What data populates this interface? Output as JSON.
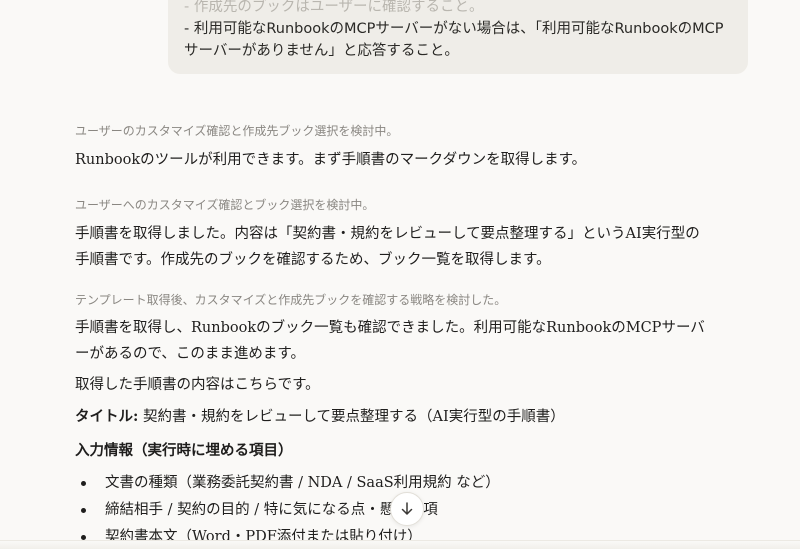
{
  "user_message": {
    "line_faded": "- 作成先のブックはユーザーに確認すること。",
    "line1": "- 利用可能なRunbookのMCPサーバーがない場合は、「利用可能なRunbookのMCP",
    "line2": "サーバーがありません」と応答すること。"
  },
  "assistant": {
    "thought1": "ユーザーのカスタマイズ確認と作成先ブック選択を検討中。",
    "para1": "Runbookのツールが利用できます。まず手順書のマークダウンを取得します。",
    "thought2": "ユーザーへのカスタマイズ確認とブック選択を検討中。",
    "para2_line1": "手順書を取得しました。内容は「契約書・規約をレビューして要点整理する」というAI実行型の",
    "para2_line2": "手順書です。作成先のブックを確認するため、ブック一覧を取得します。",
    "thought3": "テンプレート取得後、カスタマイズと作成先ブックを確認する戦略を検討した。",
    "para3_line1": "手順書を取得し、Runbookのブック一覧も確認できました。利用可能なRunbookのMCPサーバ",
    "para3_line2": "ーがあるので、このまま進めます。",
    "para4": "取得した手順書の内容はこちらです。",
    "title_label": "タイトル:",
    "title_value": " 契約書・規約をレビューして要点整理する（AI実行型の手順書）",
    "input_heading": "入力情報（実行時に埋める項目）",
    "bullets": [
      "文書の種類（業務委託契約書 / NDA / SaaS利用規約 など）",
      "締結相手 / 契約の目的 / 特に気になる点・懸念事項",
      "契約書本文（Word・PDF添付または貼り付け）"
    ]
  },
  "icons": {
    "scroll_down": "arrow-down-icon"
  }
}
